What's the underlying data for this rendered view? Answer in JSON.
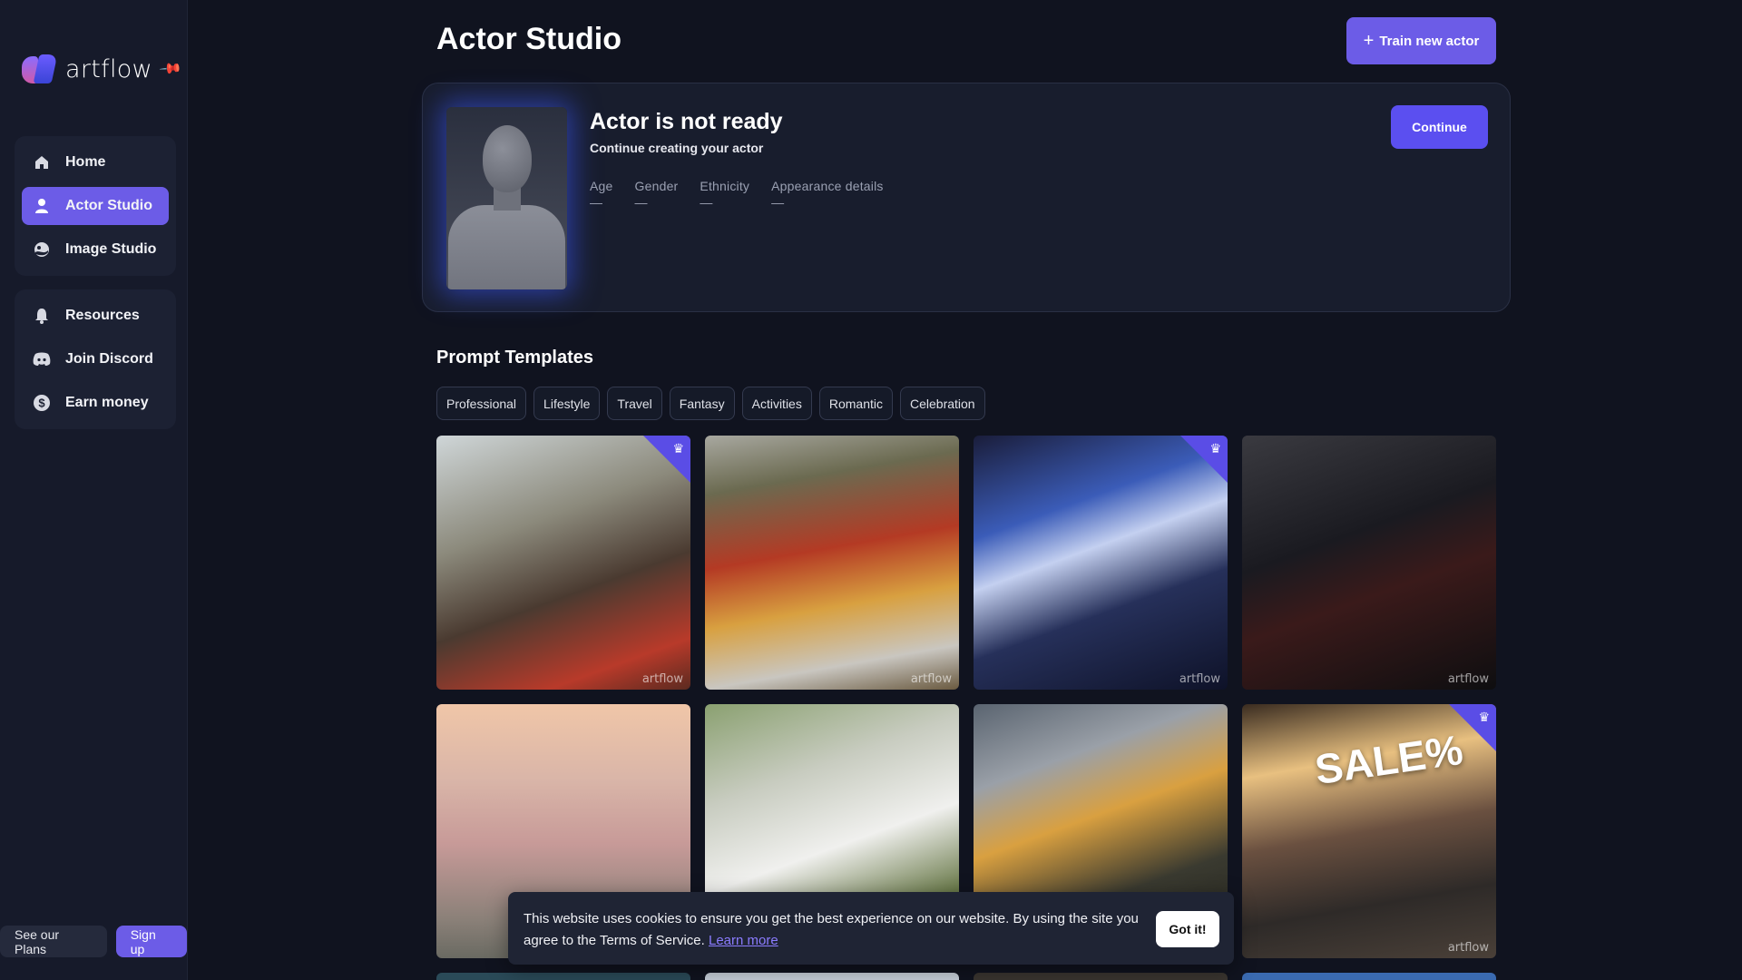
{
  "app": {
    "logo_text": "artflow"
  },
  "sidebar": {
    "group1": [
      {
        "label": "Home",
        "icon": "home-icon",
        "active": false
      },
      {
        "label": "Actor Studio",
        "icon": "user-icon",
        "active": true
      },
      {
        "label": "Image Studio",
        "icon": "image-icon",
        "active": false
      }
    ],
    "group2": [
      {
        "label": "Resources",
        "icon": "bell-icon",
        "active": false
      },
      {
        "label": "Join Discord",
        "icon": "discord-icon",
        "active": false
      },
      {
        "label": "Earn money",
        "icon": "dollar-icon",
        "active": false
      }
    ],
    "plans_label": "See our Plans",
    "signup_label": "Sign up"
  },
  "header": {
    "title": "Actor Studio",
    "train_label": "Train new actor"
  },
  "actor": {
    "title": "Actor is not ready",
    "subtitle": "Continue creating your actor",
    "continue_label": "Continue",
    "attributes": [
      {
        "label": "Age",
        "value": "—"
      },
      {
        "label": "Gender",
        "value": "—"
      },
      {
        "label": "Ethnicity",
        "value": "—"
      },
      {
        "label": "Appearance details",
        "value": "—"
      }
    ]
  },
  "templates": {
    "title": "Prompt Templates",
    "categories": [
      "Professional",
      "Lifestyle",
      "Travel",
      "Fantasy",
      "Activities",
      "Romantic",
      "Celebration"
    ],
    "watermark": "artflow",
    "tiles": [
      {
        "premium": true
      },
      {
        "premium": false
      },
      {
        "premium": true
      },
      {
        "premium": false
      },
      {
        "premium": false
      },
      {
        "premium": false
      },
      {
        "premium": false
      },
      {
        "premium": true,
        "sign_text": "SALE%"
      }
    ]
  },
  "cookie": {
    "text": "This website uses cookies to ensure you get the best experience on our website. By using the site you agree to the Terms of Service.",
    "link_label": "Learn more",
    "accept_label": "Got it!"
  },
  "colors": {
    "accent": "#6c5ce7",
    "background": "#10131f",
    "sidebar": "#161a2a"
  }
}
